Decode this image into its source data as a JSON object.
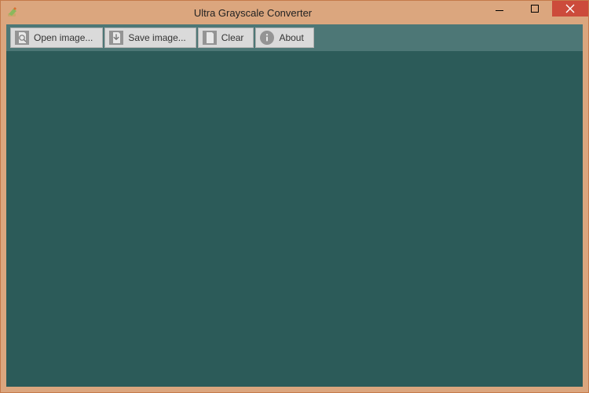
{
  "window": {
    "title": "Ultra Grayscale Converter"
  },
  "toolbar": {
    "open_label": "Open image...",
    "save_label": "Save image...",
    "clear_label": "Clear",
    "about_label": "About"
  }
}
